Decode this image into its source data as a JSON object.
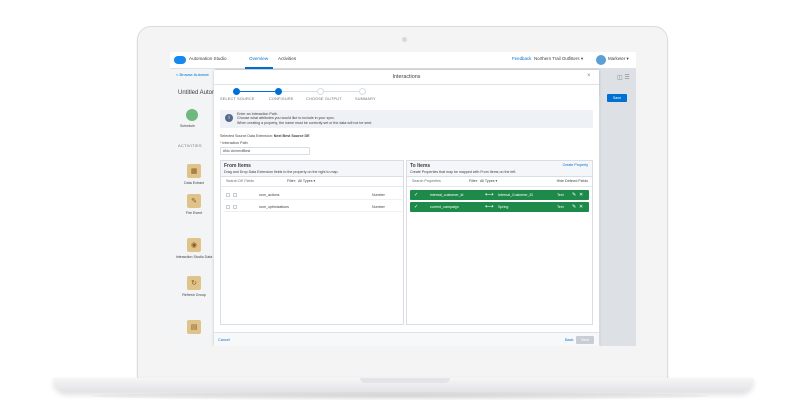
{
  "topbar": {
    "app_title": "Automation Studio",
    "tabs": [
      {
        "label": "Overview"
      },
      {
        "label": "Activities"
      }
    ],
    "feedback": "Feedback",
    "business_unit": "Northern Trail Outfitters ▾",
    "user": "Marketer ▾"
  },
  "background": {
    "breadcrumb": "< Browse Automat",
    "automation_title": "Untitled Autom",
    "schedule_label": "Schedule",
    "activities_heading": "ACTIVITIES",
    "activities": [
      {
        "label": "Data Extract",
        "icon": "data-extract-icon"
      },
      {
        "label": "Fire Event",
        "icon": "fire-event-icon"
      },
      {
        "label": "Interaction Studio Data",
        "icon": "interaction-studio-icon"
      },
      {
        "label": "Refresh Group",
        "icon": "refresh-group-icon"
      },
      {
        "label": "",
        "icon": "document-icon"
      }
    ],
    "side_button": "Save"
  },
  "modal": {
    "title": "Interactions",
    "close": "×",
    "steps": [
      {
        "label": "SELECT SOURCE",
        "done": true
      },
      {
        "label": "CONFIGURE",
        "done": true
      },
      {
        "label": "CHOOSE OUTPUT",
        "done": false
      },
      {
        "label": "SUMMARY",
        "done": false
      }
    ],
    "info": {
      "line1": "Enter an Interaction Path.",
      "line2": "Choose what attributes you would like to include in your sync.",
      "line3": "When creating a property, the name must be correctly set or the data will not be sent."
    },
    "selected_source_label": "Selected Source Data Extension:",
    "selected_source_value": "Next Best Source DE",
    "path_label": "Interaction Path",
    "path_value": "#No Un/nextBest",
    "from_items": {
      "title": "From Items",
      "subtitle": "Drag and Drop Data Extension fields to the property on the right to map.",
      "search_placeholder": "Search DE Fields",
      "filter_label": "Filter:",
      "filter_value": "All Types ▾",
      "rows": [
        {
          "name": "num_actions",
          "type": "Number"
        },
        {
          "name": "num_optimizations",
          "type": "Number"
        }
      ]
    },
    "to_items": {
      "title": "To Items",
      "subtitle": "Create Properties that may be mapped with From Items on the left.",
      "create_property": "Create Property",
      "search_placeholder": "Search Properties",
      "filter_label": "Filter:",
      "filter_value": "All Types ▾",
      "hide_defined": "Hide Defined Fields",
      "mappings": [
        {
          "source": "internal_customer_id",
          "target": "Internal_Customer_ID",
          "type": "Text"
        },
        {
          "source": "current_campaign",
          "target": "Spring",
          "type": "Text"
        }
      ]
    },
    "footer": {
      "cancel": "Cancel",
      "back": "Back",
      "next": "Next"
    }
  },
  "colors": {
    "brand_blue": "#0070d2",
    "mapped_green": "#1e8a4a",
    "info_bg": "#eef1f6"
  }
}
